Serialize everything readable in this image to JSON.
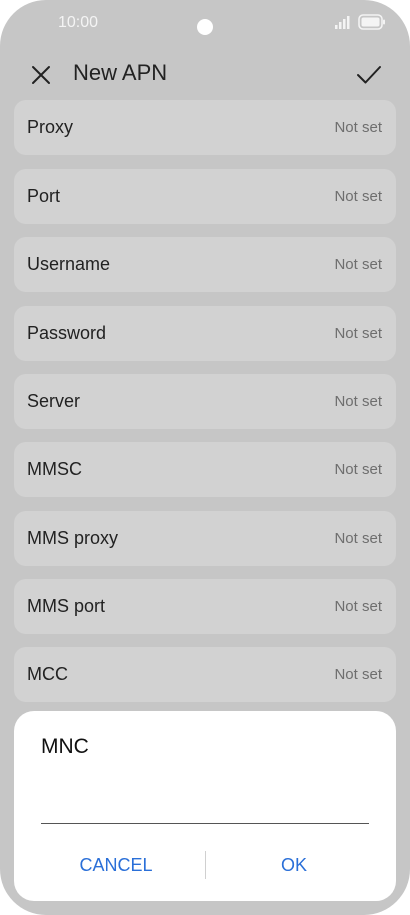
{
  "status_bar": {
    "time": "10:00"
  },
  "header": {
    "title": "New APN"
  },
  "settings": [
    {
      "label": "Proxy",
      "value": "Not set"
    },
    {
      "label": "Port",
      "value": "Not set"
    },
    {
      "label": "Username",
      "value": "Not set"
    },
    {
      "label": "Password",
      "value": "Not set"
    },
    {
      "label": "Server",
      "value": "Not set"
    },
    {
      "label": "MMSC",
      "value": "Not set"
    },
    {
      "label": "MMS proxy",
      "value": "Not set"
    },
    {
      "label": "MMS port",
      "value": "Not set"
    },
    {
      "label": "MCC",
      "value": "Not set"
    }
  ],
  "dialog": {
    "title": "MNC",
    "input_value": "",
    "cancel_label": "CANCEL",
    "ok_label": "OK"
  },
  "icons": {
    "close": "close-icon",
    "confirm": "check-icon",
    "signal": "signal-icon",
    "battery": "battery-icon"
  },
  "colors": {
    "accent": "#2a6fd8",
    "scrim_background": "#c6c6c6",
    "row_background": "#d2d2d2"
  }
}
